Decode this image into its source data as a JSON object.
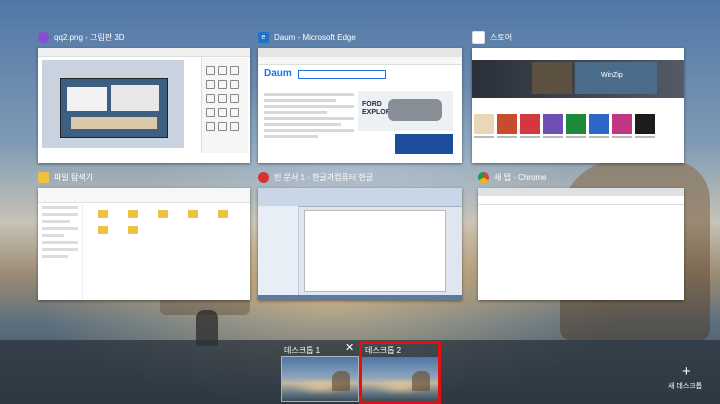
{
  "windows": [
    {
      "id": "paint3d",
      "title": "qq2.png - 그림판 3D",
      "icon": "paint3d-icon"
    },
    {
      "id": "edge",
      "title": "Daum - Microsoft Edge",
      "icon": "edge-icon"
    },
    {
      "id": "store",
      "title": "스토어",
      "icon": "store-icon"
    },
    {
      "id": "explorer",
      "title": "파일 탐색기",
      "icon": "folder-icon"
    },
    {
      "id": "hwp",
      "title": "빈 문서 1 - 한글과컴퓨터 한글",
      "icon": "hwp-icon"
    },
    {
      "id": "chrome",
      "title": "새 탭 - Chrome",
      "icon": "chrome-icon"
    }
  ],
  "edge_content": {
    "logo": "Daum",
    "ad_headline": "FORD EXPLORER"
  },
  "store_content": {
    "hero_app": "WinZip"
  },
  "desktops": [
    {
      "label": "데스크톱 1",
      "active": true
    },
    {
      "label": "데스크톱 2",
      "active": false
    }
  ],
  "new_desktop_label": "새 데스크톱",
  "colors": {
    "highlight": "#e41010",
    "bar": "rgba(40,48,58,0.72)"
  }
}
